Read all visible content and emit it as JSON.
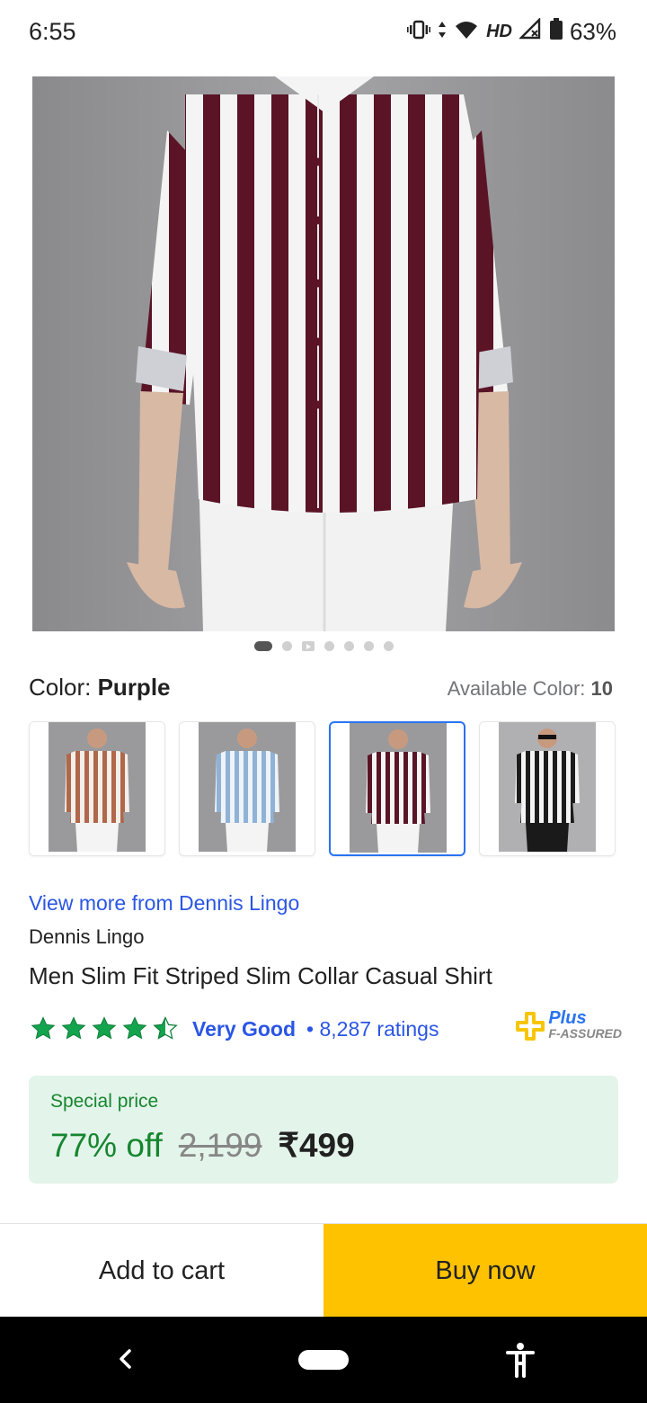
{
  "status": {
    "time": "6:55",
    "network": "HD",
    "battery": "63%",
    "icons": [
      "vibrate-icon",
      "data-arrows-icon",
      "wifi-icon",
      "signal-icon",
      "battery-icon"
    ]
  },
  "product": {
    "image_dots_count": 7,
    "color_label": "Color:",
    "color_value": "Purple",
    "available_label": "Available Color:",
    "available_count": "10",
    "swatches": [
      {
        "stripe": "#b0674a",
        "selected": false
      },
      {
        "stripe": "#8fb2d6",
        "selected": false
      },
      {
        "stripe": "#5a1426",
        "selected": true
      },
      {
        "stripe": "#1c1c1c",
        "selected": false
      }
    ],
    "brand_link": "View more from Dennis Lingo",
    "brand": "Dennis Lingo",
    "title": "Men Slim Fit Striped Slim Collar Casual Shirt",
    "rating_stars": 4.5,
    "rating_text": "Very Good",
    "ratings_count": "• 8,287 ratings",
    "assured_plus": "Plus",
    "assured_label": "F-ASSURED"
  },
  "price": {
    "special_label": "Special price",
    "discount": "77% off",
    "mrp": "2,199",
    "final": "₹499"
  },
  "actions": {
    "add_to_cart": "Add to cart",
    "buy_now": "Buy now"
  },
  "colors": {
    "accent_blue": "#2a55e5",
    "buy_yellow": "#ffc200",
    "green": "#16862f",
    "shirt_stripe": "#5a1426"
  }
}
